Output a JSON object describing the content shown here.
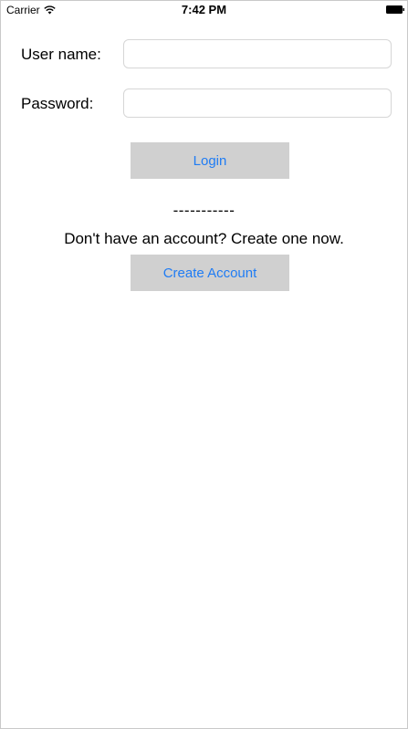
{
  "status_bar": {
    "carrier": "Carrier",
    "time": "7:42 PM",
    "wifi_icon": "wifi-icon",
    "battery_icon": "battery-icon"
  },
  "form": {
    "username_label": "User name:",
    "username_value": "",
    "password_label": "Password:",
    "password_value": "",
    "login_label": "Login"
  },
  "signup": {
    "divider": "-----------",
    "prompt": "Don't have an account? Create one now.",
    "create_label": "Create Account"
  },
  "colors": {
    "button_bg": "#d0d0d0",
    "button_text": "#1f7cf4"
  }
}
